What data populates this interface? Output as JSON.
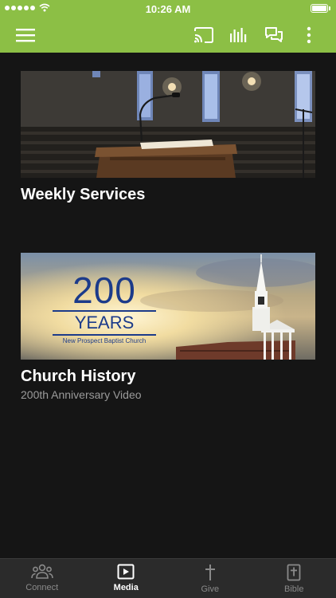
{
  "status_bar": {
    "time": "10:26 AM"
  },
  "app_bar": {
    "accent_color": "#8cbf45",
    "actions": [
      "cast-icon",
      "stats-icon",
      "chat-icon",
      "more-icon"
    ]
  },
  "cards": [
    {
      "title": "Weekly Services",
      "subtitle": "",
      "image": "pulpit-sanctuary-photo"
    },
    {
      "title": "Church History",
      "subtitle": "200th Anniversary Video",
      "image": "church-steeple-photo",
      "image_text": {
        "number": "200",
        "years": "YEARS",
        "church": "New Prospect Baptist Church"
      }
    }
  ],
  "tabs": [
    {
      "label": "Connect",
      "icon": "people-icon",
      "active": false
    },
    {
      "label": "Media",
      "icon": "play-icon",
      "active": true
    },
    {
      "label": "Give",
      "icon": "cross-icon",
      "active": false
    },
    {
      "label": "Bible",
      "icon": "bible-icon",
      "active": false
    }
  ]
}
